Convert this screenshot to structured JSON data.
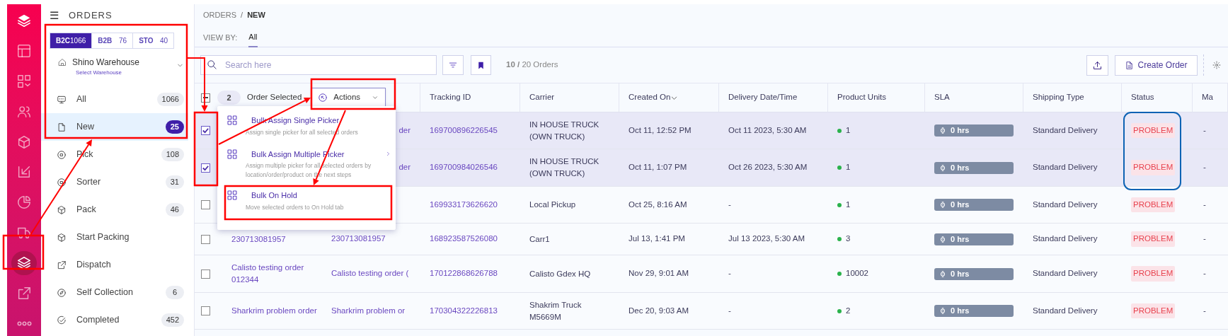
{
  "rail": {
    "items": [
      {
        "kind": "layout",
        "selected": false
      },
      {
        "kind": "apps",
        "selected": false
      },
      {
        "kind": "users",
        "selected": false
      },
      {
        "kind": "box",
        "selected": false
      },
      {
        "kind": "inbox",
        "selected": false
      },
      {
        "kind": "pie",
        "selected": false
      },
      {
        "kind": "truck",
        "selected": false
      },
      {
        "kind": "layers",
        "selected": true
      },
      {
        "kind": "external",
        "selected": false
      },
      {
        "kind": "more",
        "selected": false
      }
    ]
  },
  "sidebar": {
    "menu_icon": "☰",
    "title": "ORDERS",
    "channel_tabs": [
      {
        "label": "B2C",
        "count": "1066",
        "selected": true
      },
      {
        "label": "B2B",
        "count": "76",
        "selected": false
      },
      {
        "label": "STO",
        "count": "40",
        "selected": false
      }
    ],
    "warehouse": {
      "name": "Shino Warehouse",
      "hint": "Select Warehouse"
    },
    "items": [
      {
        "kind": "monitor",
        "label": "All",
        "count": "1066",
        "selected": false
      },
      {
        "kind": "file",
        "label": "New",
        "count": "25",
        "selected": true
      },
      {
        "kind": "target",
        "label": "Pick",
        "count": "108",
        "selected": false
      },
      {
        "kind": "target",
        "label": "Sorter",
        "count": "31",
        "selected": false
      },
      {
        "kind": "box",
        "label": "Pack",
        "count": "46",
        "selected": false
      },
      {
        "kind": "box",
        "label": "Start Packing",
        "selected": false
      },
      {
        "kind": "external",
        "label": "Dispatch",
        "selected": false
      },
      {
        "kind": "compass",
        "label": "Self Collection",
        "count": "6",
        "selected": false
      },
      {
        "kind": "check",
        "label": "Completed",
        "count": "452",
        "selected": false
      }
    ]
  },
  "breadcrumb": {
    "parent": "ORDERS",
    "separator": "/",
    "current": "NEW"
  },
  "view_by": {
    "label": "VIEW BY:",
    "tabs": [
      {
        "label": "All",
        "selected": true
      }
    ]
  },
  "toolbar": {
    "search_placeholder": "Search here",
    "count_text": "**10 /** 20 Orders",
    "create_order": "Create Order"
  },
  "selection": {
    "indeterminate": true,
    "count": "2",
    "label": "Order Selected",
    "actions": "Actions"
  },
  "actions_menu": [
    {
      "title": "Bulk Assign Single Picker",
      "description": "Assign single picker for all selected orders",
      "submenu": false
    },
    {
      "title": "Bulk Assign Multiple Picker",
      "description": "Assign multiple picker for all selected orders by location/order/product on the next steps",
      "submenu": true
    },
    {
      "title": "Bulk On Hold",
      "description": "Move selected orders to On Hold tab",
      "submenu": false
    }
  ],
  "columns": [
    {
      "label": "Tracking ID",
      "sorted": false
    },
    {
      "label": "Carrier",
      "sorted": false
    },
    {
      "label": "Created On",
      "sorted": true
    },
    {
      "label": "Delivery Date/Time",
      "sorted": false
    },
    {
      "label": "Product Units",
      "sorted": false
    },
    {
      "label": "SLA",
      "sorted": false
    },
    {
      "label": "Shipping Type",
      "sorted": false
    },
    {
      "label": "Status",
      "sorted": false
    },
    {
      "label": "Ma",
      "sorted": false
    }
  ],
  "rows": [
    {
      "selected": true,
      "order_ref": "der",
      "ref_clipped": true,
      "tracking": "169700896226545",
      "carrier": "IN HOUSE TRUCK (OWN TRUCK)",
      "created": "Oct 11, 12:52 PM",
      "delivery": "Oct 11 2023, 5:30 AM",
      "units": "1",
      "sla": "0 hrs",
      "shipping": "Standard Delivery",
      "status": "PROBLEM",
      "column_9": "-"
    },
    {
      "selected": true,
      "order_ref": "der",
      "ref_clipped": true,
      "tracking": "169700984026546",
      "carrier": "IN HOUSE TRUCK (OWN TRUCK)",
      "created": "Oct 11, 1:07 PM",
      "delivery": "Oct 26 2023, 5:30 AM",
      "units": "1",
      "sla": "0 hrs",
      "shipping": "Standard Delivery",
      "status": "PROBLEM",
      "column_9": "-"
    },
    {
      "selected": false,
      "tracking": "169933173626620",
      "carrier": "Local Pickup",
      "created": "Oct 25, 8:16 AM",
      "delivery": "-",
      "units": "1",
      "sla": "0 hrs",
      "shipping": "Standard Delivery",
      "status": "PROBLEM",
      "column_9": "-"
    },
    {
      "selected": false,
      "order_no": "230713081957",
      "order_ref": "230713081957",
      "ref_clipped": false,
      "tracking": "168923587526080",
      "carrier": "Carr1",
      "created": "Jul 13, 1:41 PM",
      "delivery": "Jul 13 2023, 5:30 AM",
      "units": "3",
      "sla": "0 hrs",
      "shipping": "Standard Delivery",
      "status": "PROBLEM",
      "column_9": "-"
    },
    {
      "selected": false,
      "order_no": "Calisto testing order 012344",
      "order_ref": "Calisto testing order (",
      "ref_clipped": false,
      "tracking": "170122868626788",
      "carrier": "Calisto Gdex HQ",
      "created": "Nov 29, 9:01 AM",
      "delivery": "-",
      "units": "10002",
      "sla": "0 hrs",
      "shipping": "Standard Delivery",
      "status": "PROBLEM",
      "column_9": "-"
    },
    {
      "selected": false,
      "order_no": "Sharkrim problem order",
      "order_ref": "Sharkrim problem or",
      "ref_clipped": false,
      "tracking": "170304322226813",
      "carrier": "Shakrim Truck M5669M",
      "created": "Dec 20, 9:03 AM",
      "delivery": "-",
      "units": "2",
      "sla": "0 hrs",
      "shipping": "Standard Delivery",
      "status": "PROBLEM",
      "column_9": "-"
    }
  ]
}
